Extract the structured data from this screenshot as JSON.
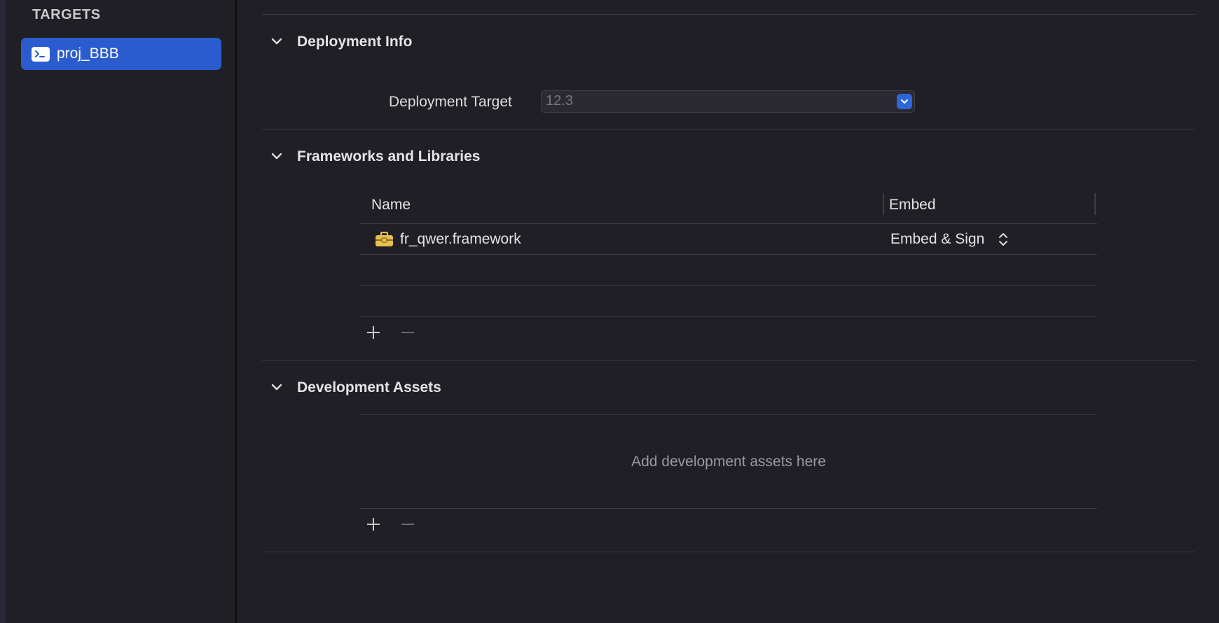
{
  "sidebar": {
    "header": "TARGETS",
    "items": [
      {
        "label": "proj_BBB",
        "icon": "terminal-icon",
        "selected": true
      }
    ]
  },
  "sections": {
    "deployment": {
      "title": "Deployment Info",
      "target_label": "Deployment Target",
      "target_value": "12.3"
    },
    "frameworks": {
      "title": "Frameworks and Libraries",
      "columns": [
        "Name",
        "Embed"
      ],
      "rows": [
        {
          "name": "fr_qwer.framework",
          "icon": "toolbox-icon",
          "embed": "Embed & Sign"
        }
      ]
    },
    "assets": {
      "title": "Development Assets",
      "placeholder": "Add development assets here"
    }
  },
  "colors": {
    "accent": "#2a5cd0",
    "background": "#201f25",
    "framework_icon": "#e9bf4f"
  }
}
